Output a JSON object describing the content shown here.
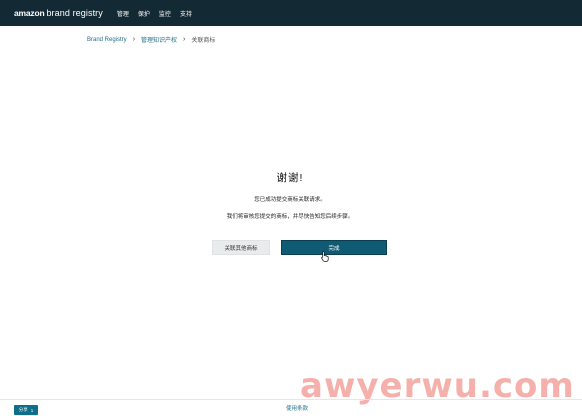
{
  "header": {
    "logo_amazon": "amazon",
    "logo_brand": "brand registry",
    "nav": [
      "管理",
      "保护",
      "监控",
      "支持"
    ]
  },
  "breadcrumb": {
    "home": "Brand Registry",
    "middle": "管理知识产权",
    "current": "关联商标"
  },
  "confirmation": {
    "title": "谢谢!",
    "line1": "您已成功提交商标关联请求。",
    "line2": "我们将审核您提交的商标，并尽快告知您后续步骤。"
  },
  "actions": {
    "secondary_label": "关联其他商标",
    "primary_label": "完成"
  },
  "footer": {
    "share_label": "分享",
    "share_count": "1",
    "terms_label": "使用条款"
  },
  "watermark": "awyerwu.com",
  "colors": {
    "topbar": "#132a35",
    "primary": "#0f5b73",
    "link": "#1f6e8c",
    "watermark": "#f4a8a3"
  }
}
